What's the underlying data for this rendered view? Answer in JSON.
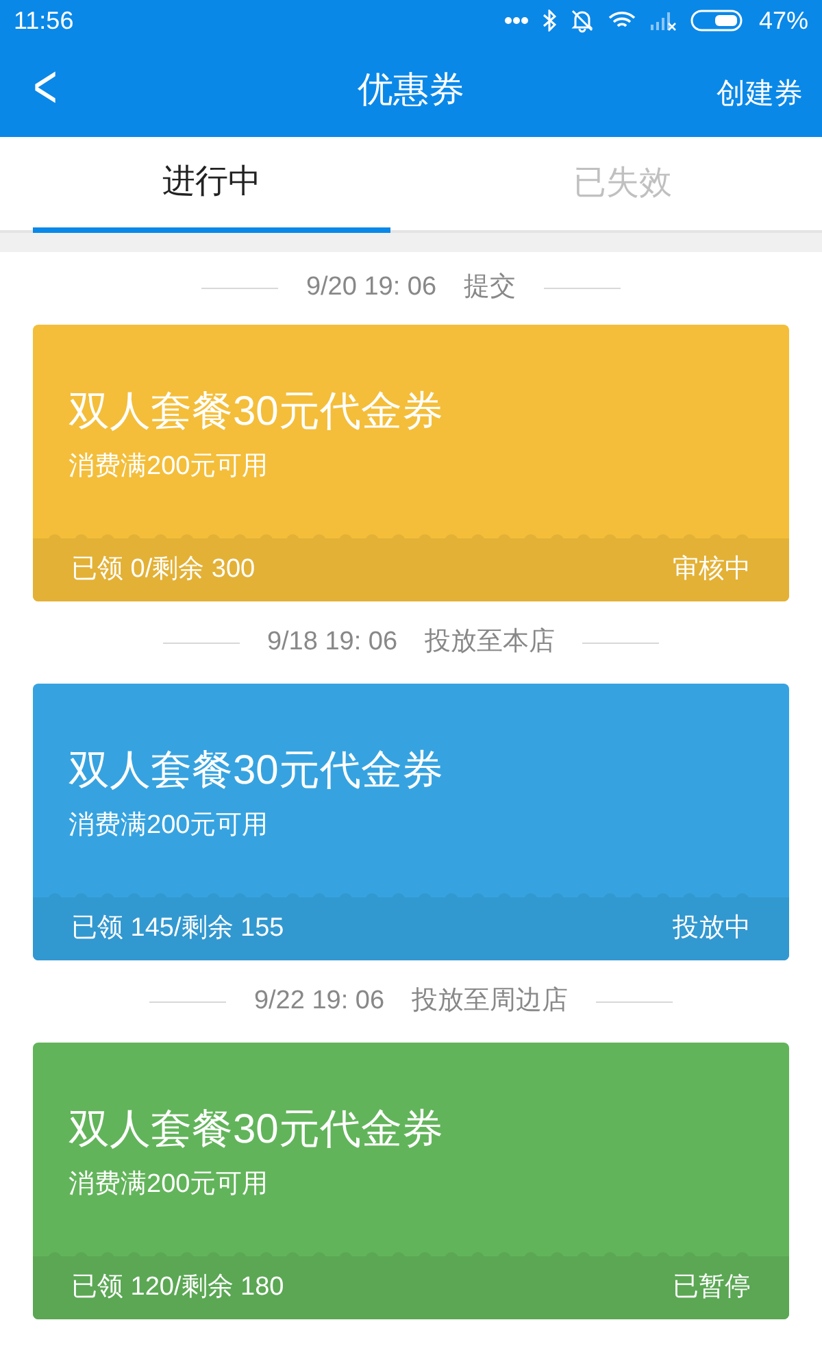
{
  "status_bar": {
    "time": "11:56",
    "battery": "47%"
  },
  "header": {
    "back": "<",
    "title": "优惠券",
    "action": "创建券"
  },
  "tabs": [
    {
      "label": "进行中",
      "selected": true
    },
    {
      "label": "已失效",
      "selected": false
    }
  ],
  "coupons": [
    {
      "date": "9/20 19: 06",
      "note": "提交",
      "title": "双人套餐30元代金券",
      "condition": "消费满200元可用",
      "stats": "已领 0/剩余 300",
      "status": "审核中",
      "color": "#f4be3a"
    },
    {
      "date": "9/18 19: 06",
      "note": "投放至本店",
      "title": "双人套餐30元代金券",
      "condition": "消费满200元可用",
      "stats": "已领 145/剩余 155",
      "status": "投放中",
      "color": "#36a3e0"
    },
    {
      "date": "9/22 19: 06",
      "note": "投放至周边店",
      "title": "双人套餐30元代金券",
      "condition": "消费满200元可用",
      "stats": "已领 120/剩余 180",
      "status": "已暂停",
      "color": "#62b45a"
    }
  ]
}
